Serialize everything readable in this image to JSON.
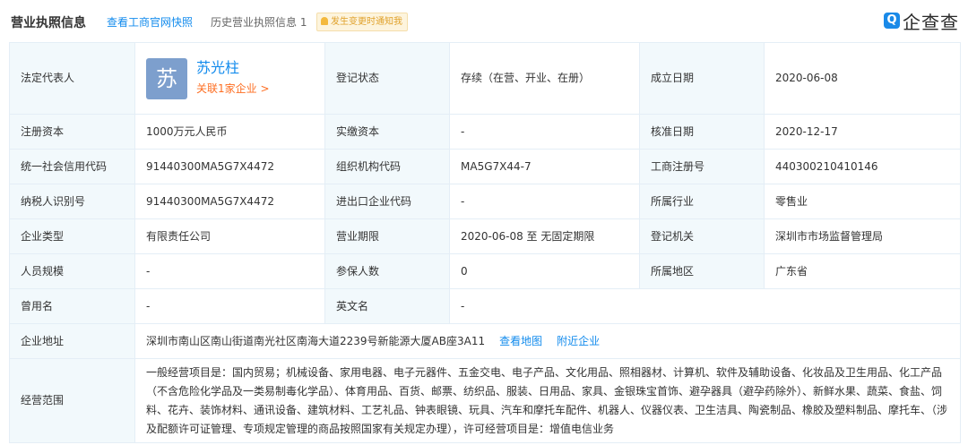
{
  "header": {
    "title": "营业执照信息",
    "gov_link": "查看工商官网快照",
    "history": "历史营业执照信息 1",
    "notify": "发生变更时通知我",
    "logo_mark": "Q",
    "logo_name": "企查查"
  },
  "legal_rep": {
    "label": "法定代表人",
    "avatar_char": "苏",
    "name": "苏光柱",
    "related": "关联1家企业 >"
  },
  "fields": {
    "reg_status_label": "登记状态",
    "reg_status": "存续（在营、开业、在册）",
    "found_date_label": "成立日期",
    "found_date": "2020-06-08",
    "reg_capital_label": "注册资本",
    "reg_capital": "1000万元人民币",
    "paid_capital_label": "实缴资本",
    "paid_capital": "-",
    "approve_date_label": "核准日期",
    "approve_date": "2020-12-17",
    "credit_code_label": "统一社会信用代码",
    "credit_code": "91440300MA5G7X4472",
    "org_code_label": "组织机构代码",
    "org_code": "MA5G7X44-7",
    "biz_reg_no_label": "工商注册号",
    "biz_reg_no": "440300210410146",
    "taxpayer_label": "纳税人识别号",
    "taxpayer": "91440300MA5G7X4472",
    "import_export_label": "进出口企业代码",
    "import_export": "-",
    "industry_label": "所属行业",
    "industry": "零售业",
    "company_type_label": "企业类型",
    "company_type": "有限责任公司",
    "biz_term_label": "营业期限",
    "biz_term": "2020-06-08 至 无固定期限",
    "reg_authority_label": "登记机关",
    "reg_authority": "深圳市市场监督管理局",
    "staff_size_label": "人员规模",
    "staff_size": "-",
    "insured_label": "参保人数",
    "insured": "0",
    "region_label": "所属地区",
    "region": "广东省",
    "former_name_label": "曾用名",
    "former_name": "-",
    "english_name_label": "英文名",
    "english_name": "-",
    "address_label": "企业地址",
    "address": "深圳市南山区南山街道南光社区南海大道2239号新能源大厦AB座3A11",
    "view_map": "查看地图",
    "nearby": "附近企业",
    "scope_label": "经营范围",
    "scope": "一般经营项目是：国内贸易；机械设备、家用电器、电子元器件、五金交电、电子产品、文化用品、照相器材、计算机、软件及辅助设备、化妆品及卫生用品、化工产品（不含危险化学品及一类易制毒化学品）、体育用品、百货、邮票、纺织品、服装、日用品、家具、金银珠宝首饰、避孕器具（避孕药除外）、新鲜水果、蔬菜、食盐、饲料、花卉、装饰材料、通讯设备、建筑材料、工艺礼品、钟表眼镜、玩具、汽车和摩托车配件、机器人、仪器仪表、卫生洁具、陶瓷制品、橡胶及塑料制品、摩托车、（涉及配额许可证管理、专项规定管理的商品按照国家有关规定办理），许可经营项目是：增值电信业务"
  }
}
